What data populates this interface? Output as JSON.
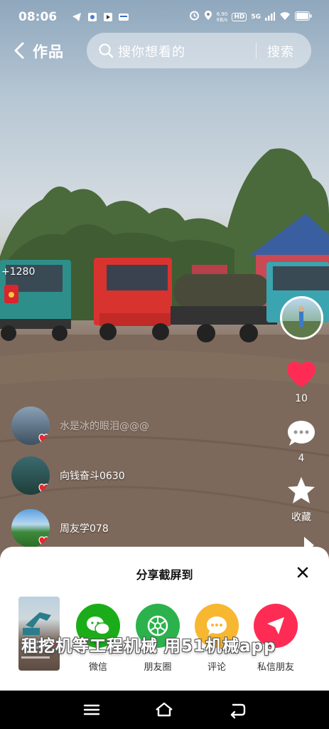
{
  "status_bar": {
    "time": "08:06",
    "speed_value": "6.90",
    "speed_unit": "KB/s",
    "hd": "HD",
    "network": "5G"
  },
  "top_bar": {
    "title": "作品",
    "search_placeholder": "搜你想看的",
    "search_button": "搜索"
  },
  "video": {
    "reward_count": "+1280",
    "overlay_caption": "租挖机等工程机械 用51机械app"
  },
  "actions": {
    "like_count": "10",
    "comment_count": "4",
    "favorite_label": "收藏"
  },
  "gift_users": [
    {
      "name": "水是冰的眼泪@@@"
    },
    {
      "name": "向钱奋斗0630"
    },
    {
      "name": "周友学078"
    }
  ],
  "share_sheet": {
    "title": "分享截屏到",
    "items": [
      {
        "label": "微信",
        "color": "#1aad19"
      },
      {
        "label": "朋友圈",
        "color": "#2bb24c"
      },
      {
        "label": "评论",
        "color": "#f7b731"
      },
      {
        "label": "私信朋友",
        "color": "#fe2c55"
      }
    ]
  },
  "colors": {
    "like_red": "#fe2c55",
    "accent_heart": "#e8262e"
  }
}
